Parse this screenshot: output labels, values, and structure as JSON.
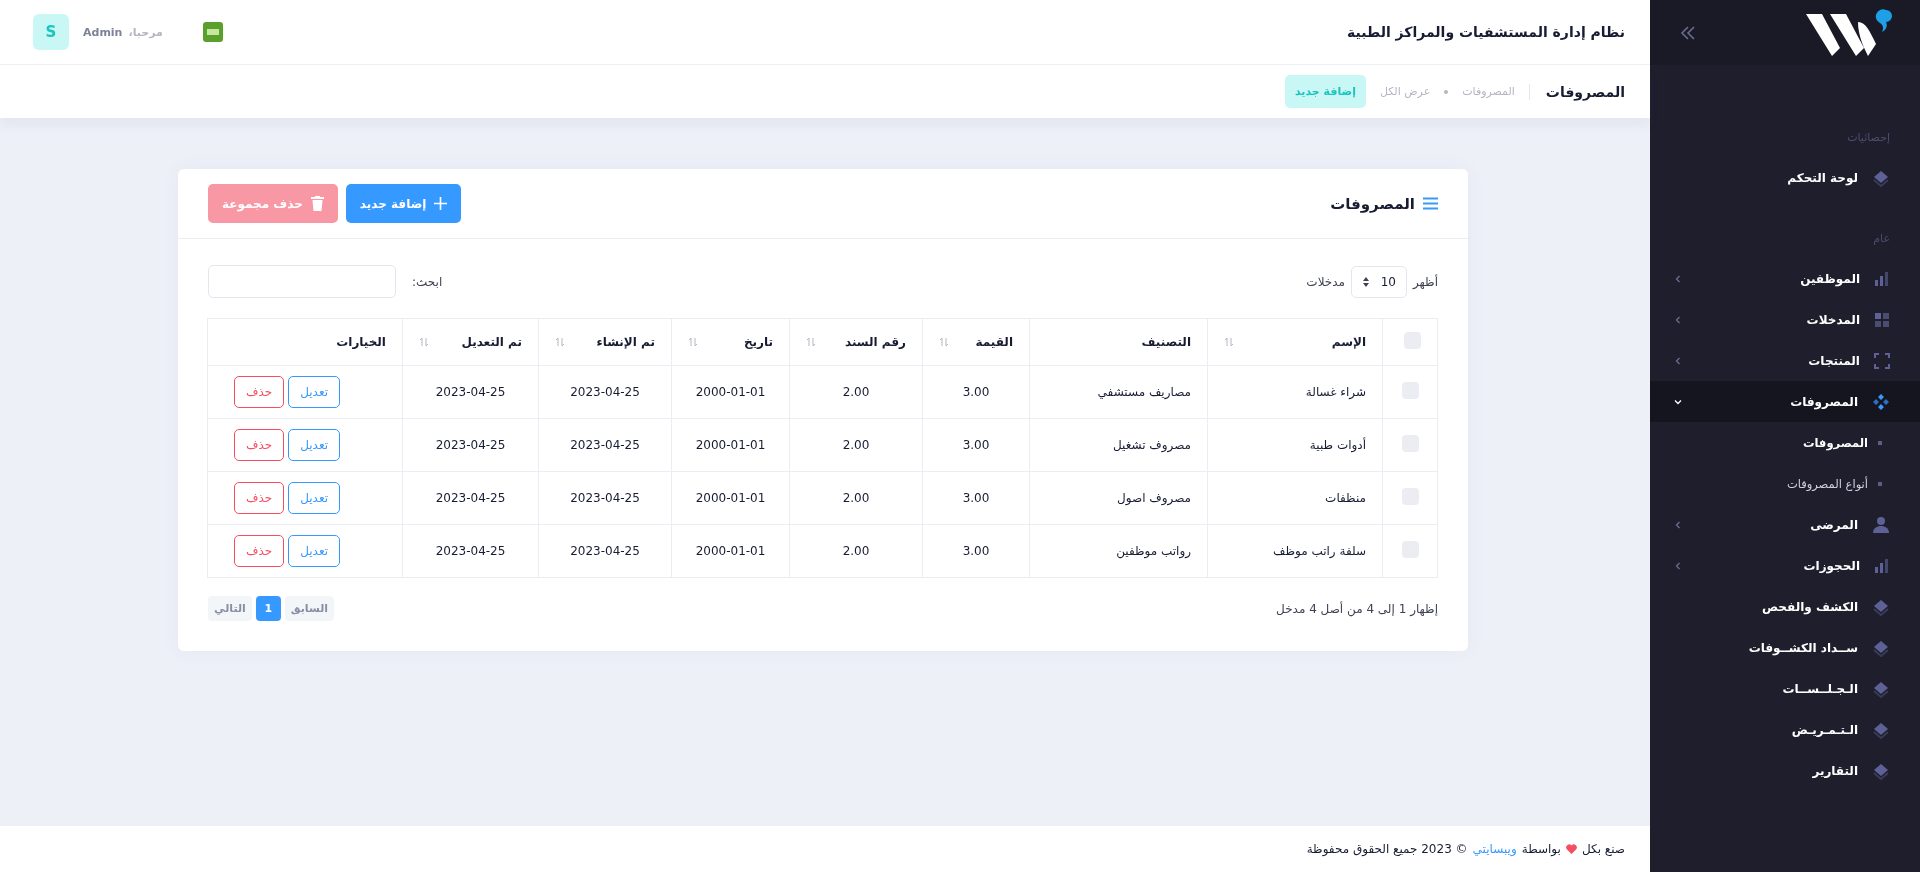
{
  "header": {
    "title": "نظام إدارة المستشفيات والمراكز الطبية",
    "greeting": "مرحبا،",
    "user": "Admin",
    "avatar": "S"
  },
  "subheader": {
    "title": "المصروفات",
    "breadcrumb": [
      "المصروفات",
      "عرض الكل"
    ],
    "button": "إضافة جديد"
  },
  "card": {
    "title": "المصروفات",
    "add_button": "إضافة جديد",
    "bulk_delete_button": "حذف مجموعة",
    "length": {
      "show": "أظهر",
      "value": "10",
      "entries": "مدخلات"
    },
    "search": {
      "label": "ابحث:"
    },
    "table": {
      "select_all_checked": false,
      "columns": [
        {
          "label": "الإسم",
          "sortable": true
        },
        {
          "label": "التصنيف",
          "sortable": false
        },
        {
          "label": "القيمة",
          "sortable": true
        },
        {
          "label": "رقم السند",
          "sortable": true
        },
        {
          "label": "تاريخ",
          "sortable": true
        },
        {
          "label": "تم الإنشاء",
          "sortable": true
        },
        {
          "label": "تم التعديل",
          "sortable": true
        },
        {
          "label": "الخيارات",
          "sortable": false
        }
      ],
      "rows": [
        {
          "checked": false,
          "cells": [
            "شراء غسالة",
            "مصاريف مستشفي",
            "3.00",
            "2.00",
            "2000-01-01",
            "2023-04-25",
            "2023-04-25"
          ],
          "actions": [
            "تعديل",
            "حذف"
          ]
        },
        {
          "checked": false,
          "cells": [
            "أدوات طبية",
            "مصروف تشغيل",
            "3.00",
            "2.00",
            "2000-01-01",
            "2023-04-25",
            "2023-04-25"
          ],
          "actions": [
            "تعديل",
            "حذف"
          ]
        },
        {
          "checked": false,
          "cells": [
            "منظفات",
            "مصروف اصول",
            "3.00",
            "2.00",
            "2000-01-01",
            "2023-04-25",
            "2023-04-25"
          ],
          "actions": [
            "تعديل",
            "حذف"
          ]
        },
        {
          "checked": false,
          "cells": [
            "سلفة راتب موظف",
            "رواتب موظفين",
            "3.00",
            "2.00",
            "2000-01-01",
            "2023-04-25",
            "2023-04-25"
          ],
          "actions": [
            "تعديل",
            "حذف"
          ]
        }
      ]
    },
    "info": "إظهار 1 إلى 4 من أصل 4 مدخل",
    "pagination": [
      {
        "label": "السابق",
        "disabled": true,
        "selected": false
      },
      {
        "label": "1",
        "disabled": false,
        "selected": true
      },
      {
        "label": "التالي",
        "disabled": true,
        "selected": false
      }
    ]
  },
  "footer": {
    "made": "صنع بكل",
    "by": "بواسطة",
    "link": "ويبسايتي",
    "rights": "© 2023 جميع الحقوق محفوظة"
  },
  "sidebar": {
    "sections": [
      {
        "title": "إحصائيات",
        "items": [
          {
            "label": "لوحة التحكم",
            "selected": false
          }
        ]
      },
      {
        "title": "عام",
        "items": [
          {
            "label": "الموظفين",
            "selected": false,
            "expanded": false
          },
          {
            "label": "المدخلات",
            "selected": false,
            "expanded": false
          },
          {
            "label": "المنتجات",
            "selected": false,
            "expanded": false
          },
          {
            "label": "المصروفات",
            "selected": true,
            "expanded": true,
            "children": [
              {
                "label": "المصروفات",
                "selected": true
              },
              {
                "label": "أنواع المصروفات",
                "selected": false
              }
            ]
          },
          {
            "label": "المرضى",
            "selected": false,
            "expanded": false
          },
          {
            "label": "الحجوزات",
            "selected": false,
            "expanded": false
          },
          {
            "label": "الكشف والفحص",
            "selected": false
          },
          {
            "label": "ســداد الكشــوفات",
            "selected": false
          },
          {
            "label": "الـجـلــســات",
            "selected": false
          },
          {
            "label": "الـتـمـريـض",
            "selected": false
          },
          {
            "label": "التقارير",
            "selected": false
          }
        ]
      }
    ]
  }
}
